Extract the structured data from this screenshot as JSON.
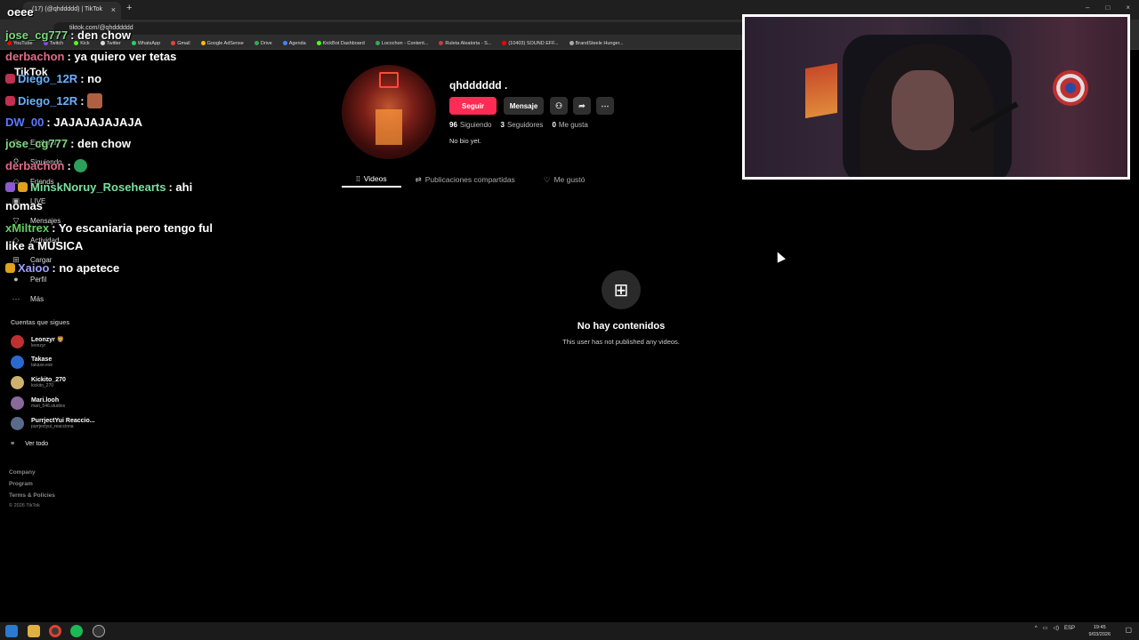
{
  "browser": {
    "tab_title": "(17) (@qhddddd) | TikTok",
    "tab_close": "×",
    "new_tab": "+",
    "url": "tiktok.com/@qhdddddd",
    "bookmarks": [
      "YouTube",
      "Twitch",
      "Kick",
      "Twitter",
      "WhatsApp",
      "Gmail",
      "Google AdSense",
      "Drive",
      "Agenda",
      "KickBot Dashboard",
      "Locochon - Content...",
      "Ruleta Aleatoria - S...",
      "(10403) SOUND EFF...",
      "BrandSteele Hunger..."
    ],
    "window_controls": [
      "–",
      "□",
      "×"
    ]
  },
  "sidebar": {
    "logo": "TikTok",
    "nav": [
      {
        "label": "Explorar",
        "icon": "compass-icon"
      },
      {
        "label": "Siguiendo",
        "icon": "following-icon"
      },
      {
        "label": "Friends",
        "icon": "friends-icon"
      },
      {
        "label": "LIVE",
        "icon": "live-icon"
      },
      {
        "label": "Mensajes",
        "icon": "messages-icon"
      },
      {
        "label": "Actividad",
        "icon": "activity-icon"
      },
      {
        "label": "Cargar",
        "icon": "upload-icon"
      },
      {
        "label": "Perfil",
        "icon": "profile-icon"
      },
      {
        "label": "Más",
        "icon": "more-icon"
      }
    ],
    "following_heading": "Cuentas que sigues",
    "accounts": [
      {
        "name": "Leonzyr 🦁",
        "handle": "leonzyr",
        "color": "#c03030"
      },
      {
        "name": "Takase",
        "handle": "takase.exe",
        "color": "#2a6ad0"
      },
      {
        "name": "Kickito_270",
        "handle": "kickito_270",
        "color": "#d0b070"
      },
      {
        "name": "Mari.looh",
        "handle": "mari_546.studios",
        "color": "#8a6a9a"
      },
      {
        "name": "PurrjectYui Reaccio...",
        "handle": "purrjectyui_reacciona",
        "color": "#5a6a8a"
      }
    ],
    "see_all": "Ver todo",
    "footer": [
      "Company",
      "Program",
      "Terms & Policies",
      "© 2026 TikTok"
    ]
  },
  "profile": {
    "username": "qhdddddd .",
    "follow_button": "Seguir",
    "message_button": "Mensaje",
    "following_count": "96",
    "following_label": "Siguiendo",
    "followers_count": "3",
    "followers_label": "Seguidores",
    "likes_count": "0",
    "likes_label": "Me gusta",
    "bio": "No bio yet.",
    "tabs": [
      "Videos",
      "Publicaciones compartidas",
      "Me gustó"
    ],
    "empty_title": "No hay contenidos",
    "empty_sub": "This user has not published any videos."
  },
  "chat": {
    "top": "oeee",
    "lines": [
      {
        "user": "jose_cg777",
        "color": "#7dd87d",
        "msg": ": den chow"
      },
      {
        "user": "derbachon",
        "color": "#e06a8a",
        "msg": ": ya quiero ver tetas"
      },
      {
        "user": "Diego_12R",
        "color": "#6ab0ff",
        "msg": ": no"
      },
      {
        "user": "Diego_12R",
        "color": "#6ab0ff",
        "msg": ":"
      },
      {
        "user": "DW_00",
        "color": "#5a7aff",
        "msg": ": JAJAJAJAJAJA"
      },
      {
        "user": "jose_cg777",
        "color": "#7dd87d",
        "msg": ": den chow"
      },
      {
        "user": "derbachon",
        "color": "#e06a8a",
        "msg": ":"
      },
      {
        "user": "MinskNoruy_Rosehearts",
        "color": "#7adfa0",
        "msg": ": ahi"
      },
      {
        "user": "",
        "color": "#ffffff",
        "msg": "nomas"
      },
      {
        "user": "xMiltrex",
        "color": "#5fd05f",
        "msg": ": Yo escaniaria pero tengo ful"
      },
      {
        "user": "",
        "color": "#ffffff",
        "msg": "like a MUSICA"
      },
      {
        "user": "Xaioo",
        "color": "#a0a0ff",
        "msg": ": no apetece"
      }
    ]
  },
  "taskbar": {
    "tray_lang": "ESP",
    "time": "19:45",
    "date": "9/03/2026"
  }
}
